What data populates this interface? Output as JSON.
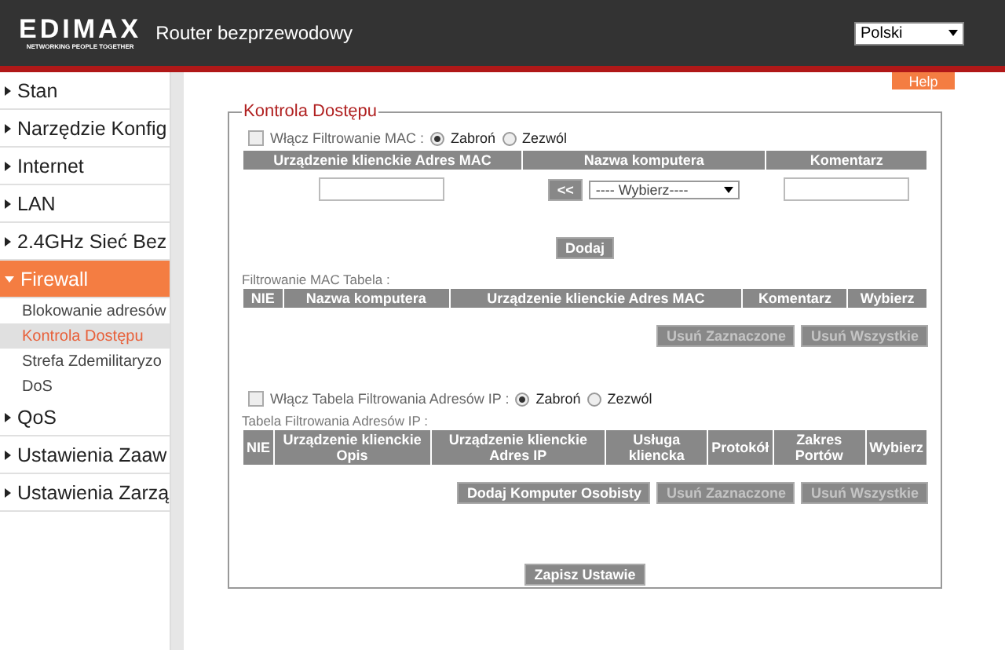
{
  "header": {
    "logo": "EDIMAX",
    "tagline": "NETWORKING PEOPLE TOGETHER",
    "title": "Router bezprzewodowy",
    "language": "Polski"
  },
  "sidebar": {
    "items": [
      {
        "label": "Stan",
        "expanded": false,
        "selected": false
      },
      {
        "label": "Narzędzie Konfig",
        "expanded": false,
        "selected": false
      },
      {
        "label": "Internet",
        "expanded": false,
        "selected": false
      },
      {
        "label": "LAN",
        "expanded": false,
        "selected": false
      },
      {
        "label": "2.4GHz Sieć Bez",
        "expanded": false,
        "selected": false
      },
      {
        "label": "Firewall",
        "expanded": true,
        "selected": true,
        "children": [
          {
            "label": "Blokowanie adresów",
            "selected": false
          },
          {
            "label": "Kontrola Dostępu",
            "selected": true
          },
          {
            "label": "Strefa Zdemilitaryzo",
            "selected": false
          },
          {
            "label": "DoS",
            "selected": false
          }
        ]
      },
      {
        "label": "QoS",
        "expanded": false,
        "selected": false
      },
      {
        "label": "Ustawienia Zaaw",
        "expanded": false,
        "selected": false
      },
      {
        "label": "Ustawienia Zarzą",
        "expanded": false,
        "selected": false
      }
    ]
  },
  "help": "Help",
  "panel": {
    "legend": "Kontrola Dostępu",
    "mac_filter": {
      "enable": {
        "label": "Włącz Filtrowanie MAC :",
        "checked": false
      },
      "modes": [
        {
          "label": "Zabroń",
          "selected": true
        },
        {
          "label": "Zezwól",
          "selected": false
        }
      ],
      "input_columns": [
        "Urządzenie klienckie  Adres MAC",
        "Nazwa komputera",
        "Komentarz"
      ],
      "copy_button": "<<",
      "computer_select": "---- Wybierz----",
      "add_button": "Dodaj",
      "table_title": "Filtrowanie MAC  Tabela :",
      "table_columns": [
        "NIE",
        "Nazwa komputera",
        "Urządzenie klienckie  Adres MAC",
        "Komentarz",
        "Wybierz"
      ],
      "buttons": [
        {
          "label": "Usuń Zaznaczone",
          "disabled": true
        },
        {
          "label": "Usuń Wszystkie",
          "disabled": true
        }
      ]
    },
    "ip_filter": {
      "enable": {
        "label": "Włącz  Tabela Filtrowania Adresów IP :",
        "checked": false
      },
      "modes": [
        {
          "label": "Zabroń",
          "selected": true
        },
        {
          "label": "Zezwól",
          "selected": false
        }
      ],
      "table_title": "Tabela Filtrowania Adresów IP :",
      "table_columns": [
        "NIE",
        "Urządzenie klienckie  Opis",
        "Urządzenie klienckie  Adres IP",
        "Usługa kliencka",
        "Protokół",
        "Zakres Portów",
        "Wybierz"
      ],
      "buttons": [
        {
          "label": "Dodaj Komputer Osobisty",
          "disabled": false
        },
        {
          "label": "Usuń Zaznaczone",
          "disabled": true
        },
        {
          "label": "Usuń Wszystkie",
          "disabled": true
        }
      ]
    },
    "save_button": "Zapisz Ustawie"
  }
}
